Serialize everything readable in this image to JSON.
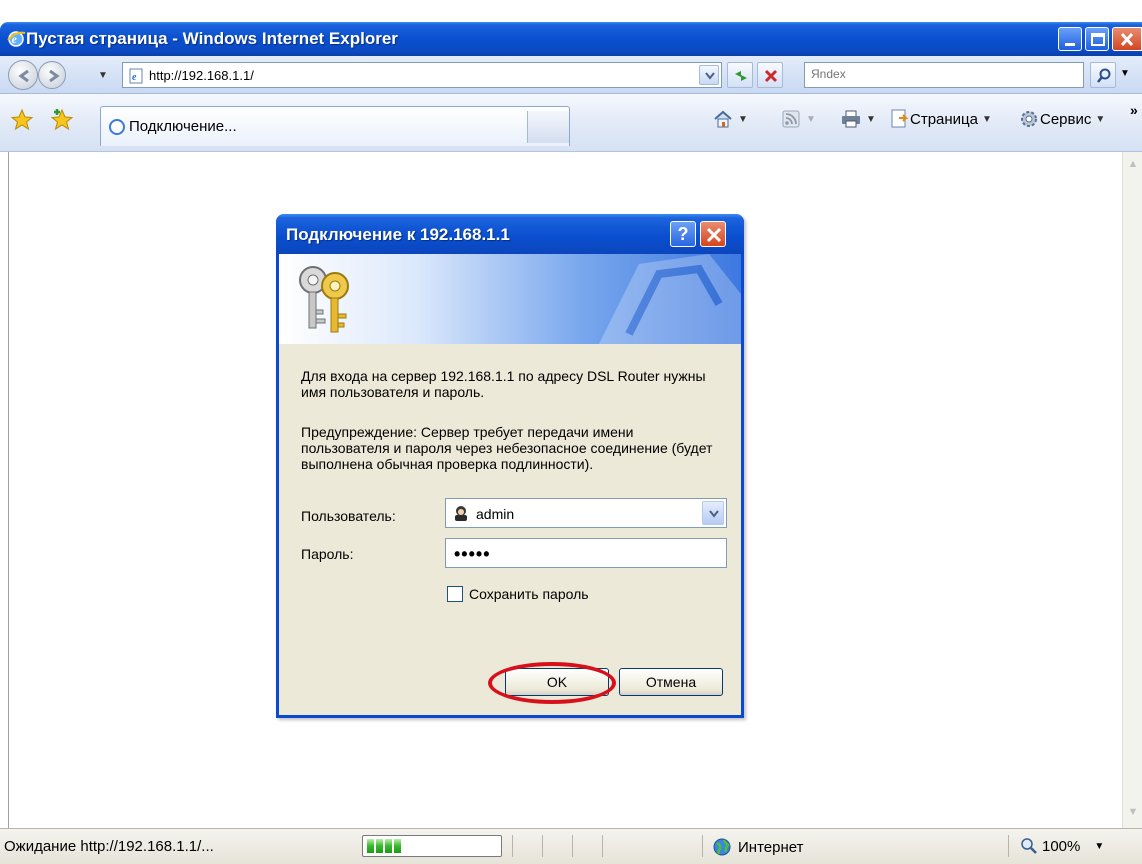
{
  "window": {
    "title": "Пустая страница - Windows Internet Explorer"
  },
  "address_bar": {
    "url": "http://192.168.1.1/",
    "search_placeholder": "Яndex"
  },
  "command_bar": {
    "tab_title": "Подключение...",
    "page_menu": "Страница",
    "tools_menu": "Сервис"
  },
  "dialog": {
    "title": "Подключение к 192.168.1.1",
    "message": "Для входа на сервер 192.168.1.1 по адресу DSL Router нужны имя пользователя и пароль.",
    "warning": "Предупреждение: Сервер требует передачи имени пользователя и пароля через небезопасное соединение (будет выполнена обычная проверка подлинности).",
    "user_label": "Пользователь:",
    "user_value": "admin",
    "password_label": "Пароль:",
    "password_value": "•••••",
    "remember_label": "Сохранить пароль",
    "remember_checked": false,
    "ok_label": "OK",
    "cancel_label": "Отмена"
  },
  "status_bar": {
    "status_text": "Ожидание http://192.168.1.1/...",
    "progress": 0.3,
    "zone": "Интернет",
    "zoom": "100%"
  },
  "colors": {
    "titlebar_blue": "#0a4fd0",
    "highlight_red": "#d8101c",
    "dialog_bg": "#ece9d8"
  }
}
